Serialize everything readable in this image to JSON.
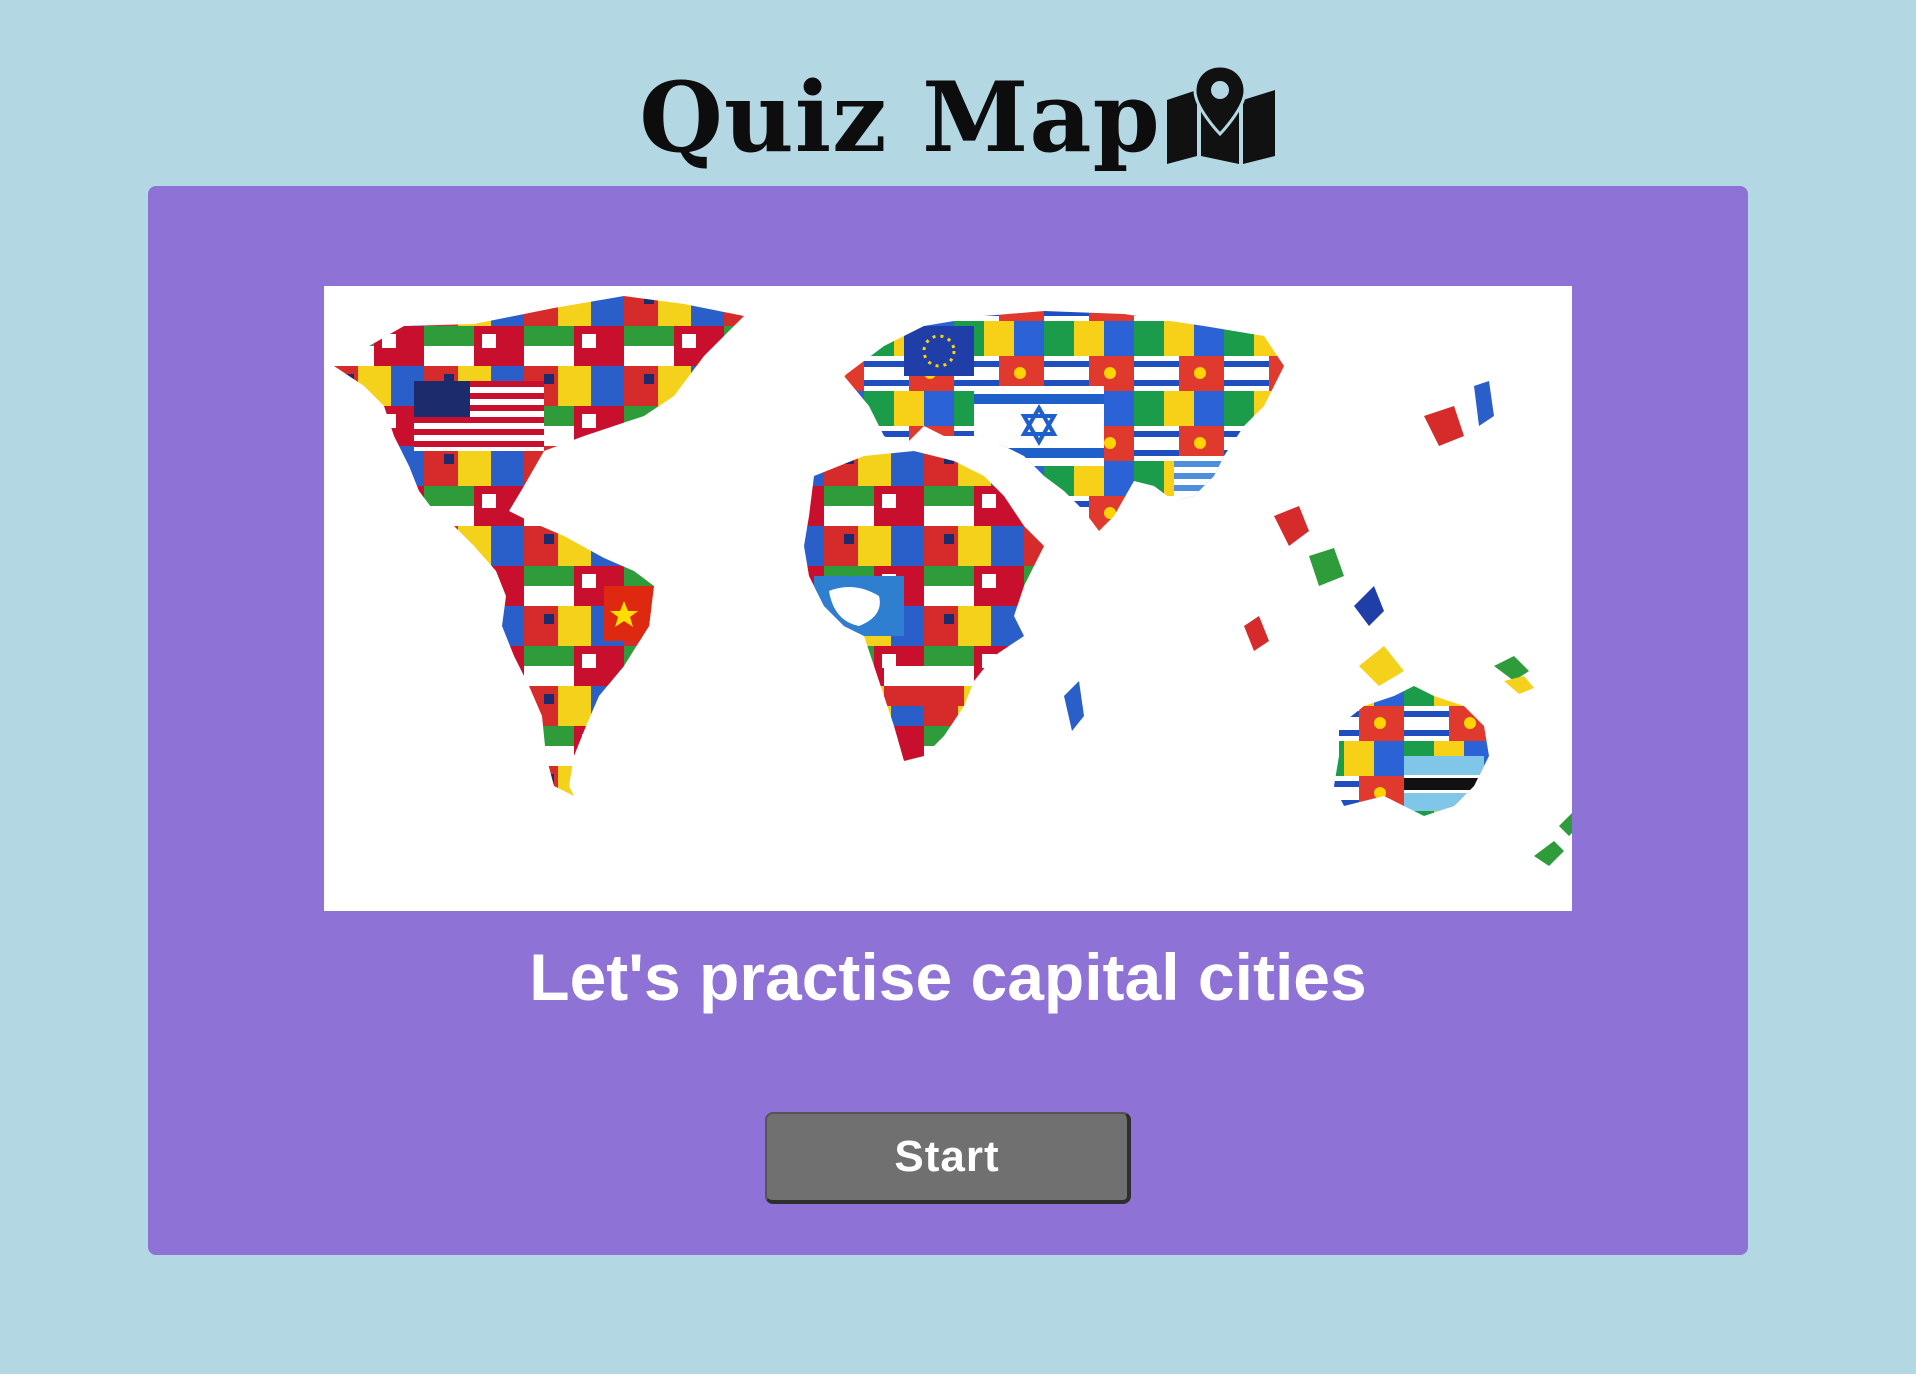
{
  "header": {
    "title": "Quiz Map",
    "icon": "map-marker-icon"
  },
  "hero": {
    "image_description": "world-map-of-flags",
    "tagline": "Let's practise capital cities"
  },
  "actions": {
    "start_label": "Start"
  },
  "colors": {
    "page_background": "#b3d8e4",
    "card_background": "#8e72d6",
    "button_background": "#707070",
    "text_light": "#ffffff",
    "title_text": "#0d0d0d"
  }
}
